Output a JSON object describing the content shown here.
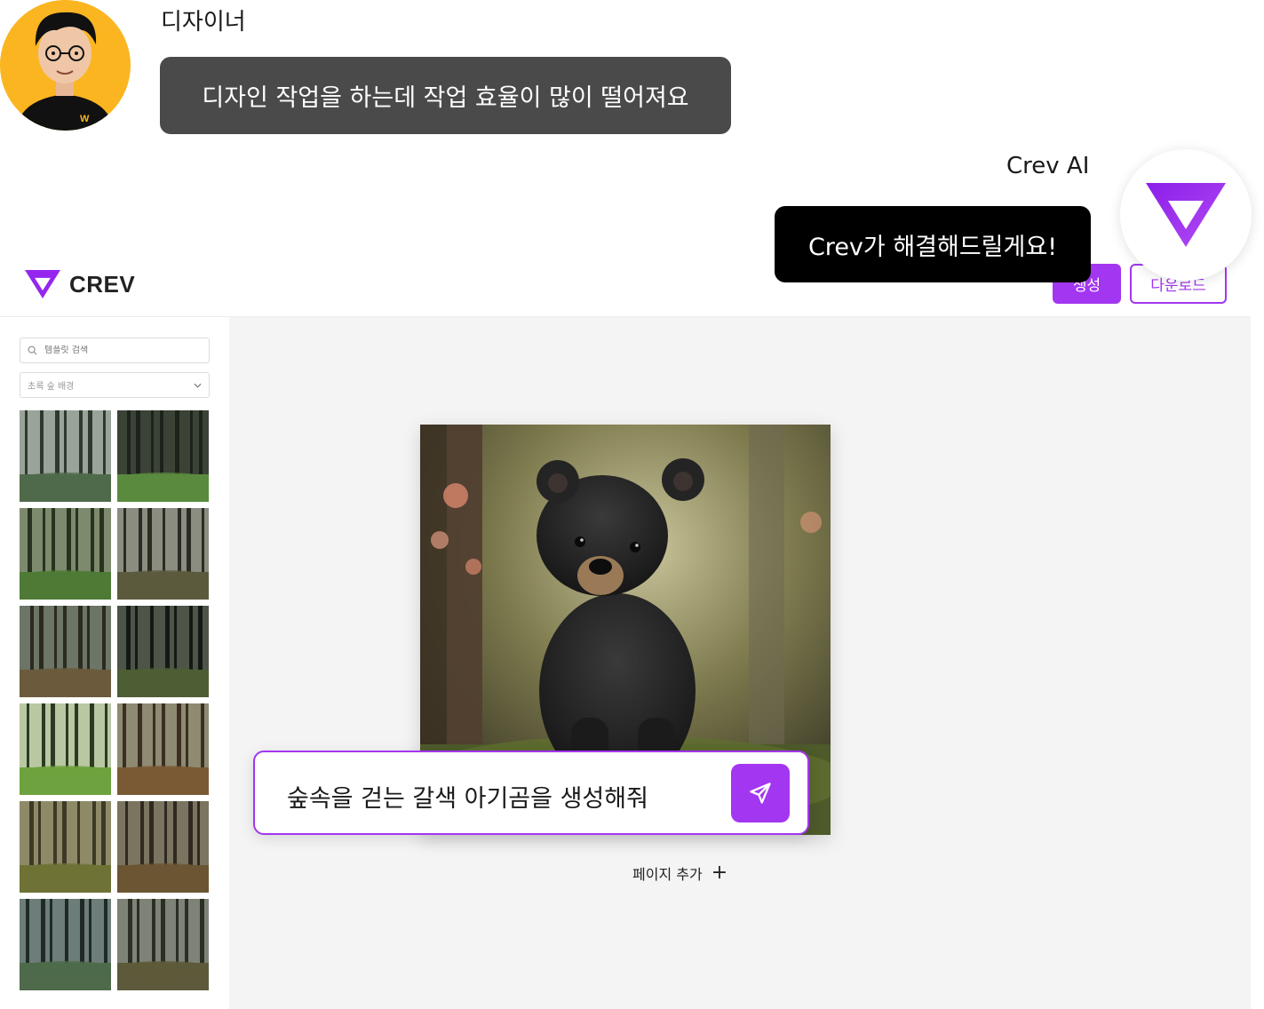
{
  "chat": {
    "user_name": "디자이너",
    "user_message": "디자인 작업을 하는데 작업 효율이 많이 떨어져요",
    "ai_name": "Crev AI",
    "ai_message": "Crev가 해결해드릴게요!"
  },
  "app": {
    "brand_name": "CREV",
    "accent_color": "#a336f0",
    "header": {
      "generate_label": "생성",
      "download_label": "다운로드"
    },
    "sidebar": {
      "search_placeholder": "템플릿 검색",
      "search_icon": "search-icon",
      "category_selected": "초록 숲 배경",
      "thumbnails": [
        {
          "icon": "forest-thumbnail"
        },
        {
          "icon": "forest-thumbnail"
        },
        {
          "icon": "forest-thumbnail"
        },
        {
          "icon": "forest-thumbnail"
        },
        {
          "icon": "forest-thumbnail"
        },
        {
          "icon": "forest-thumbnail"
        },
        {
          "icon": "forest-thumbnail"
        },
        {
          "icon": "forest-thumbnail"
        },
        {
          "icon": "forest-thumbnail"
        },
        {
          "icon": "forest-thumbnail"
        },
        {
          "icon": "forest-thumbnail"
        },
        {
          "icon": "forest-thumbnail"
        }
      ]
    },
    "canvas": {
      "page_image": "baby-black-bear-in-forest",
      "add_page_label": "페이지 추가",
      "add_icon": "plus-icon"
    },
    "prompt": {
      "text": "숲속을 걷는 갈색 아기곰을 생성해줘",
      "send_icon": "send-icon"
    }
  }
}
